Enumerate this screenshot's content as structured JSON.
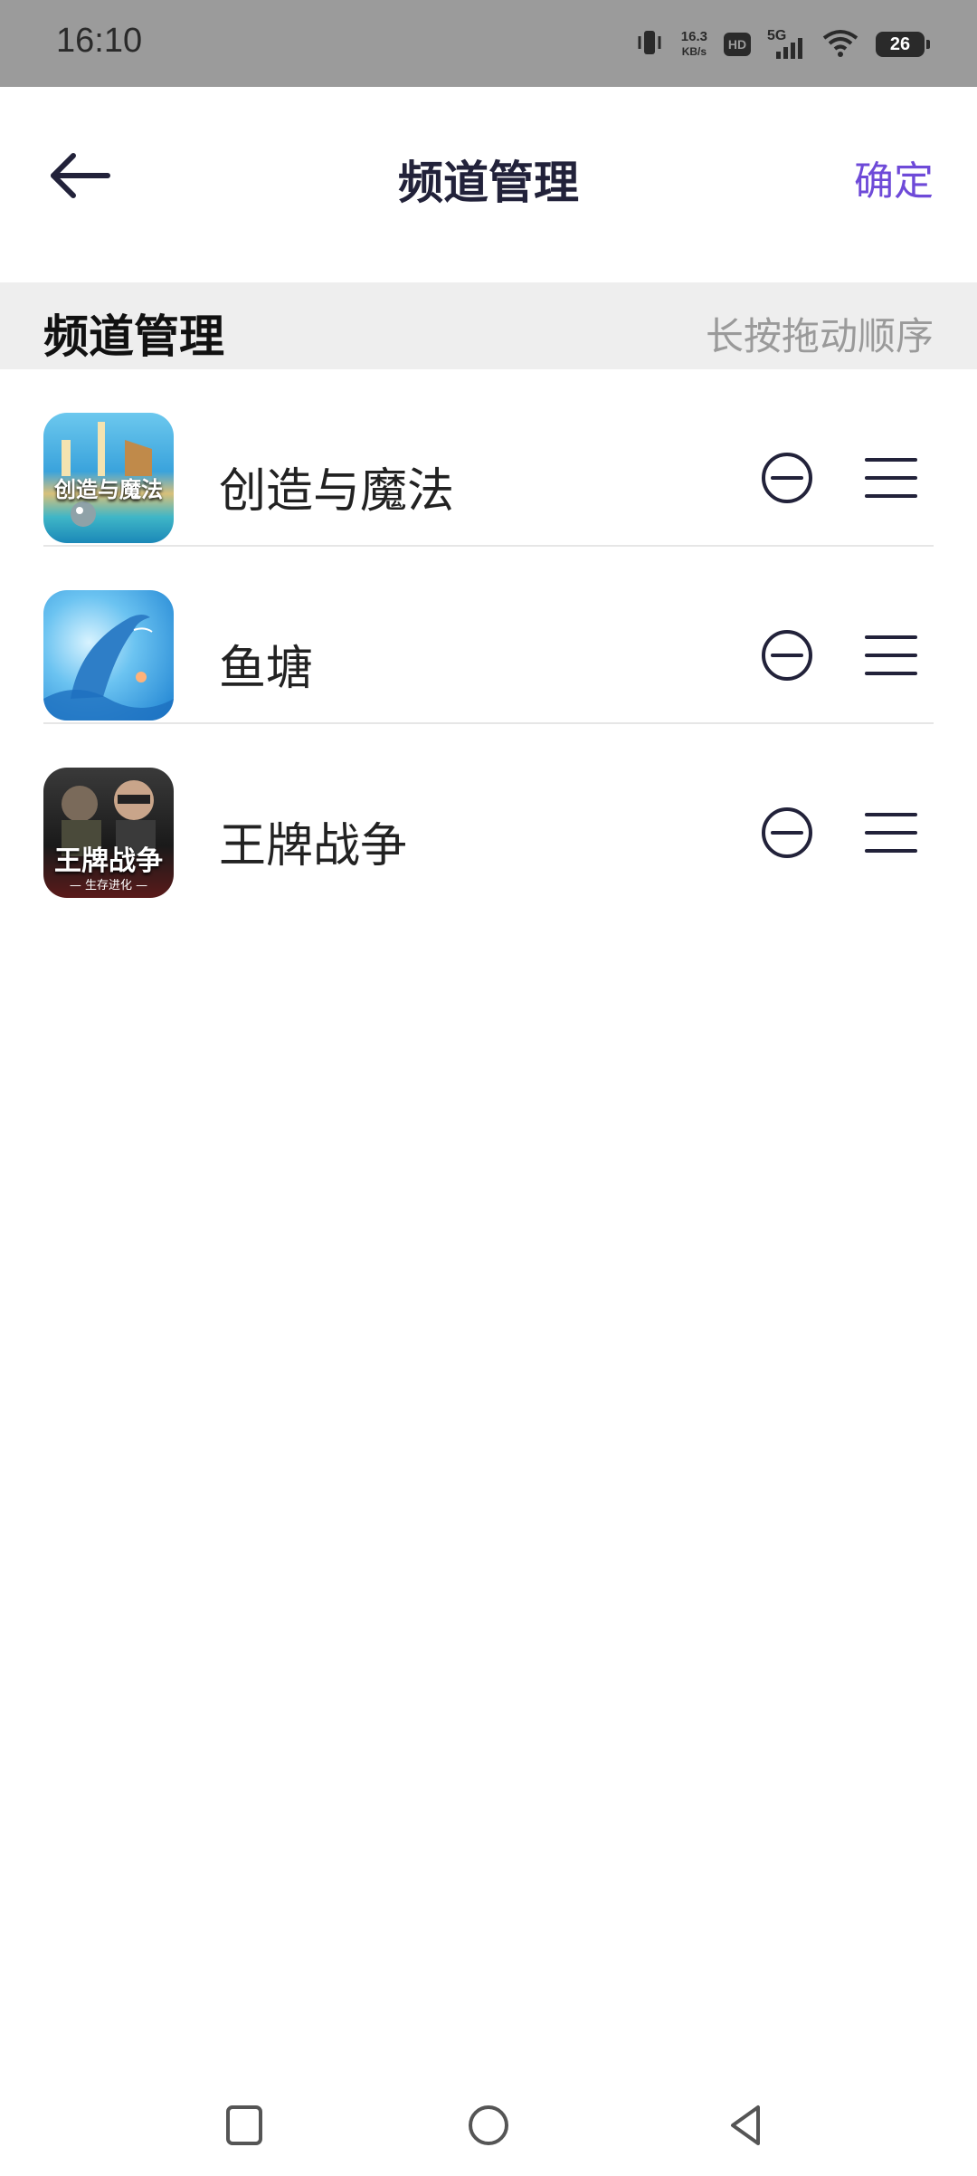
{
  "status_bar": {
    "time": "16:10",
    "speed_value": "16.3",
    "speed_unit": "KB/s",
    "hd": "HD",
    "network": "5G",
    "battery": "26"
  },
  "header": {
    "title": "频道管理",
    "confirm_label": "确定",
    "accent_color": "#6e4ad8"
  },
  "section": {
    "title": "频道管理",
    "hint": "长按拖动顺序"
  },
  "channels": [
    {
      "name": "创造与魔法",
      "thumb_label": "创造与魔法",
      "icon": "creation-magic-thumbnail"
    },
    {
      "name": "鱼塘",
      "thumb_label": "",
      "icon": "dolphin-thumbnail"
    },
    {
      "name": "王牌战争",
      "thumb_label": "王牌战争",
      "thumb_sub": "— 生存进化 —",
      "icon": "ace-war-thumbnail"
    }
  ],
  "nav": {
    "recent": "square-icon",
    "home": "circle-icon",
    "back": "triangle-back-icon"
  }
}
